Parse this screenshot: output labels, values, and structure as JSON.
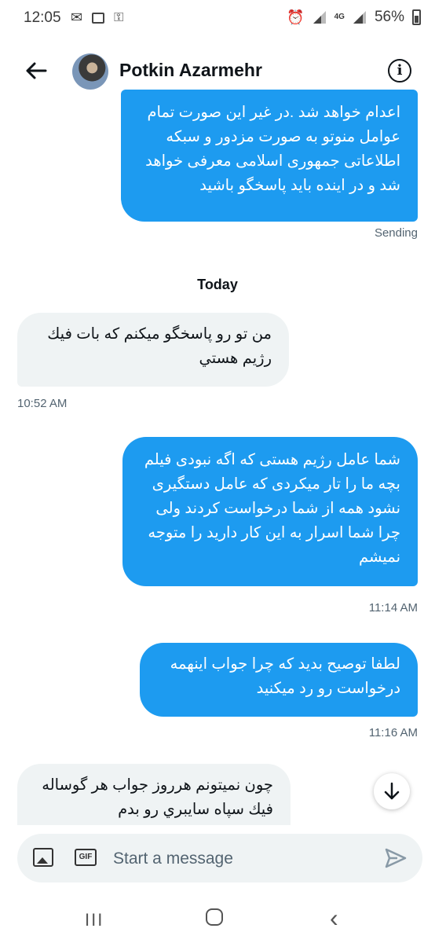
{
  "status_bar": {
    "time": "12:05",
    "battery": "56%",
    "network": "4G",
    "icons": [
      "mail-icon",
      "image-icon",
      "key-icon",
      "alarm-icon",
      "signal-icon",
      "battery-icon"
    ]
  },
  "header": {
    "back_icon": "back-arrow-icon",
    "contact_name": "Potkin Azarmehr",
    "info_icon": "info-icon"
  },
  "conversation": {
    "day_separator": "Today",
    "messages": [
      {
        "direction": "outgoing",
        "text": "اعدام خواهد شد .در غیر این صورت تمام عوامل منوتو به صورت مزدور و سبکه اطلاعاتی جمهوری اسلامی معرفی خواهد شد و در اینده باید پاسخگو باشید",
        "meta": "Sending"
      },
      {
        "direction": "incoming",
        "text": "من تو رو پاسخگو ميكنم كه بات فيك رژيم هستي",
        "meta": "10:52 AM"
      },
      {
        "direction": "outgoing",
        "text": "شما عامل رژیم هستی که اگه نبودی فیلم بچه ما را تار میکردی که عامل دستگیری نشود همه از شما درخواست کردند ولی چرا شما اسرار به این کار دارید را متوجه نمیشم",
        "meta": "11:14 AM"
      },
      {
        "direction": "outgoing",
        "text": "لطفا توصیح بدید که چرا جواب اینهمه درخواست رو رد میکنید",
        "meta": "11:16 AM"
      },
      {
        "direction": "incoming",
        "text": "چون نميتونم هرروز جواب هر گوساله فيك سپاه سايبري رو بدم",
        "meta": ""
      }
    ]
  },
  "scroll_down_icon": "arrow-down-icon",
  "composer": {
    "placeholder": "Start a message",
    "image_icon": "image-icon",
    "gif_label": "GIF",
    "send_icon": "send-icon"
  },
  "nav_bar": {
    "recent_glyph": "III",
    "home_icon": "home-icon",
    "back_glyph": "‹"
  }
}
